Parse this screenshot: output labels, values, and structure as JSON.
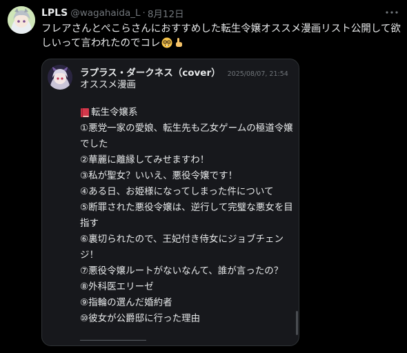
{
  "tweet": {
    "display_name": "LPLS",
    "handle": "@wagahaida_L",
    "separator": "·",
    "date": "8月12日",
    "text": "フレアさんとぺこらさんにおすすめした転生令嬢オススメ漫画リスト公開して欲しいって言われたのでコレ",
    "emojis": [
      "nerd-face-emoji",
      "index-pointing-up-emoji"
    ],
    "icons": {
      "more": "more-horizontal-icon"
    }
  },
  "quote": {
    "display_name": "ラプラス・ダークネス（cover）",
    "timestamp": "2025/08/07, 21:54",
    "subtitle": "オススメ漫画",
    "category": "転生令嬢系",
    "category_icon": "red-book-icon",
    "items": [
      "①悪党一家の愛娘、転生先も乙女ゲームの極道令嬢でした",
      "②華麗に離縁してみせますわ！",
      "③私が聖女？いいえ、悪役令嬢です！",
      "④ある日、お姫様になってしまった件について",
      "⑤断罪された悪役令嬢は、逆行して完璧な悪女を目指す",
      "⑥裏切られたので、王妃付き侍女にジョブチェンジ！",
      "⑦悪役令嬢ルートがないなんて、誰が言ったの？",
      "⑧外科医エリーゼ",
      "⑨指輪の選んだ婚約者",
      "⑩彼女が公爵邸に行った理由"
    ]
  },
  "colors": {
    "background": "#000000",
    "card": "#17181c",
    "border": "#2f3336",
    "text": "#e7e9ea",
    "muted": "#71767b"
  }
}
